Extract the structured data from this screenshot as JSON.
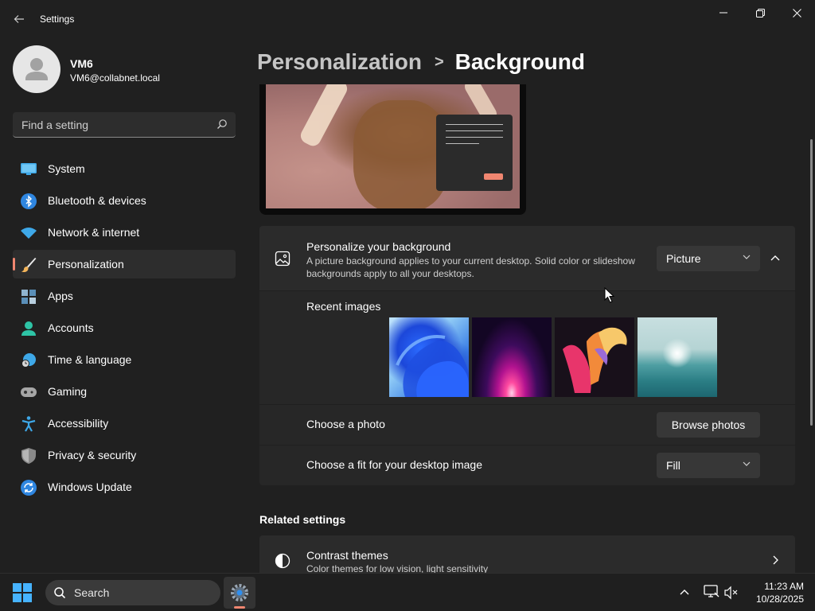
{
  "window": {
    "title": "Settings",
    "controls": [
      "minimize",
      "maximize",
      "close"
    ]
  },
  "user": {
    "name": "VM6",
    "email": "VM6@collabnet.local"
  },
  "search": {
    "placeholder": "Find a setting"
  },
  "sidebar": {
    "items": [
      {
        "label": "System",
        "icon": "monitor-icon"
      },
      {
        "label": "Bluetooth & devices",
        "icon": "bluetooth-icon"
      },
      {
        "label": "Network & internet",
        "icon": "wifi-icon"
      },
      {
        "label": "Personalization",
        "icon": "brush-icon",
        "selected": true
      },
      {
        "label": "Apps",
        "icon": "apps-icon"
      },
      {
        "label": "Accounts",
        "icon": "person-icon"
      },
      {
        "label": "Time & language",
        "icon": "globe-clock-icon"
      },
      {
        "label": "Gaming",
        "icon": "gamepad-icon"
      },
      {
        "label": "Accessibility",
        "icon": "accessibility-icon"
      },
      {
        "label": "Privacy & security",
        "icon": "shield-icon"
      },
      {
        "label": "Windows Update",
        "icon": "update-icon"
      }
    ]
  },
  "breadcrumb": {
    "parent": "Personalization",
    "separator": ">",
    "current": "Background"
  },
  "background": {
    "title": "Personalize your background",
    "description": "A picture background applies to your current desktop. Solid color or slideshow backgrounds apply to all your desktops.",
    "type_value": "Picture",
    "recent_label": "Recent images",
    "choose_photo_label": "Choose a photo",
    "browse_button": "Browse photos",
    "fit_label": "Choose a fit for your desktop image",
    "fit_value": "Fill"
  },
  "related": {
    "heading": "Related settings",
    "contrast_title": "Contrast themes",
    "contrast_desc": "Color themes for low vision, light sensitivity"
  },
  "taskbar": {
    "search_label": "Search",
    "time": "11:23 AM",
    "date": "10/28/2025"
  },
  "colors": {
    "accent": "#f08670",
    "background": "#202020",
    "card": "#2b2b2b",
    "start_blue": "#46b3ff"
  }
}
